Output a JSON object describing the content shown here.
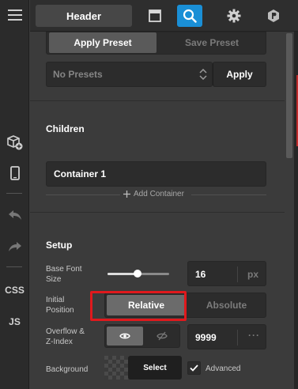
{
  "toolbar": {
    "header_label": "Header",
    "icons": [
      "layout-icon",
      "search-icon",
      "gear-icon",
      "logo-icon"
    ],
    "active_icon": "search-icon",
    "accent_color": "#1a8fd6"
  },
  "rail": {
    "items": [
      "menu-icon",
      "add-component-icon",
      "mobile-icon",
      "undo-icon",
      "redo-icon"
    ],
    "css_label": "CSS",
    "js_label": "JS"
  },
  "presets": {
    "apply_tab": "Apply Preset",
    "save_tab": "Save Preset",
    "select_value": "No Presets",
    "apply_button": "Apply"
  },
  "children": {
    "title": "Children",
    "items": [
      "Container 1"
    ],
    "add_label": "Add Container"
  },
  "setup": {
    "title": "Setup",
    "base_font_size": {
      "label": "Base Font Size",
      "value": "16",
      "unit": "px",
      "slider_fraction": 0.5
    },
    "initial_position": {
      "label": "Initial Position",
      "options": [
        "Relative",
        "Absolute"
      ],
      "selected": "Relative",
      "highlight_color": "#e0191d"
    },
    "overflow": {
      "label": "Overflow & Z-Index",
      "visibility": "visible",
      "z_index": "9999"
    },
    "background": {
      "label": "Background",
      "select_label": "Select",
      "advanced_label": "Advanced",
      "advanced_checked": true
    }
  }
}
